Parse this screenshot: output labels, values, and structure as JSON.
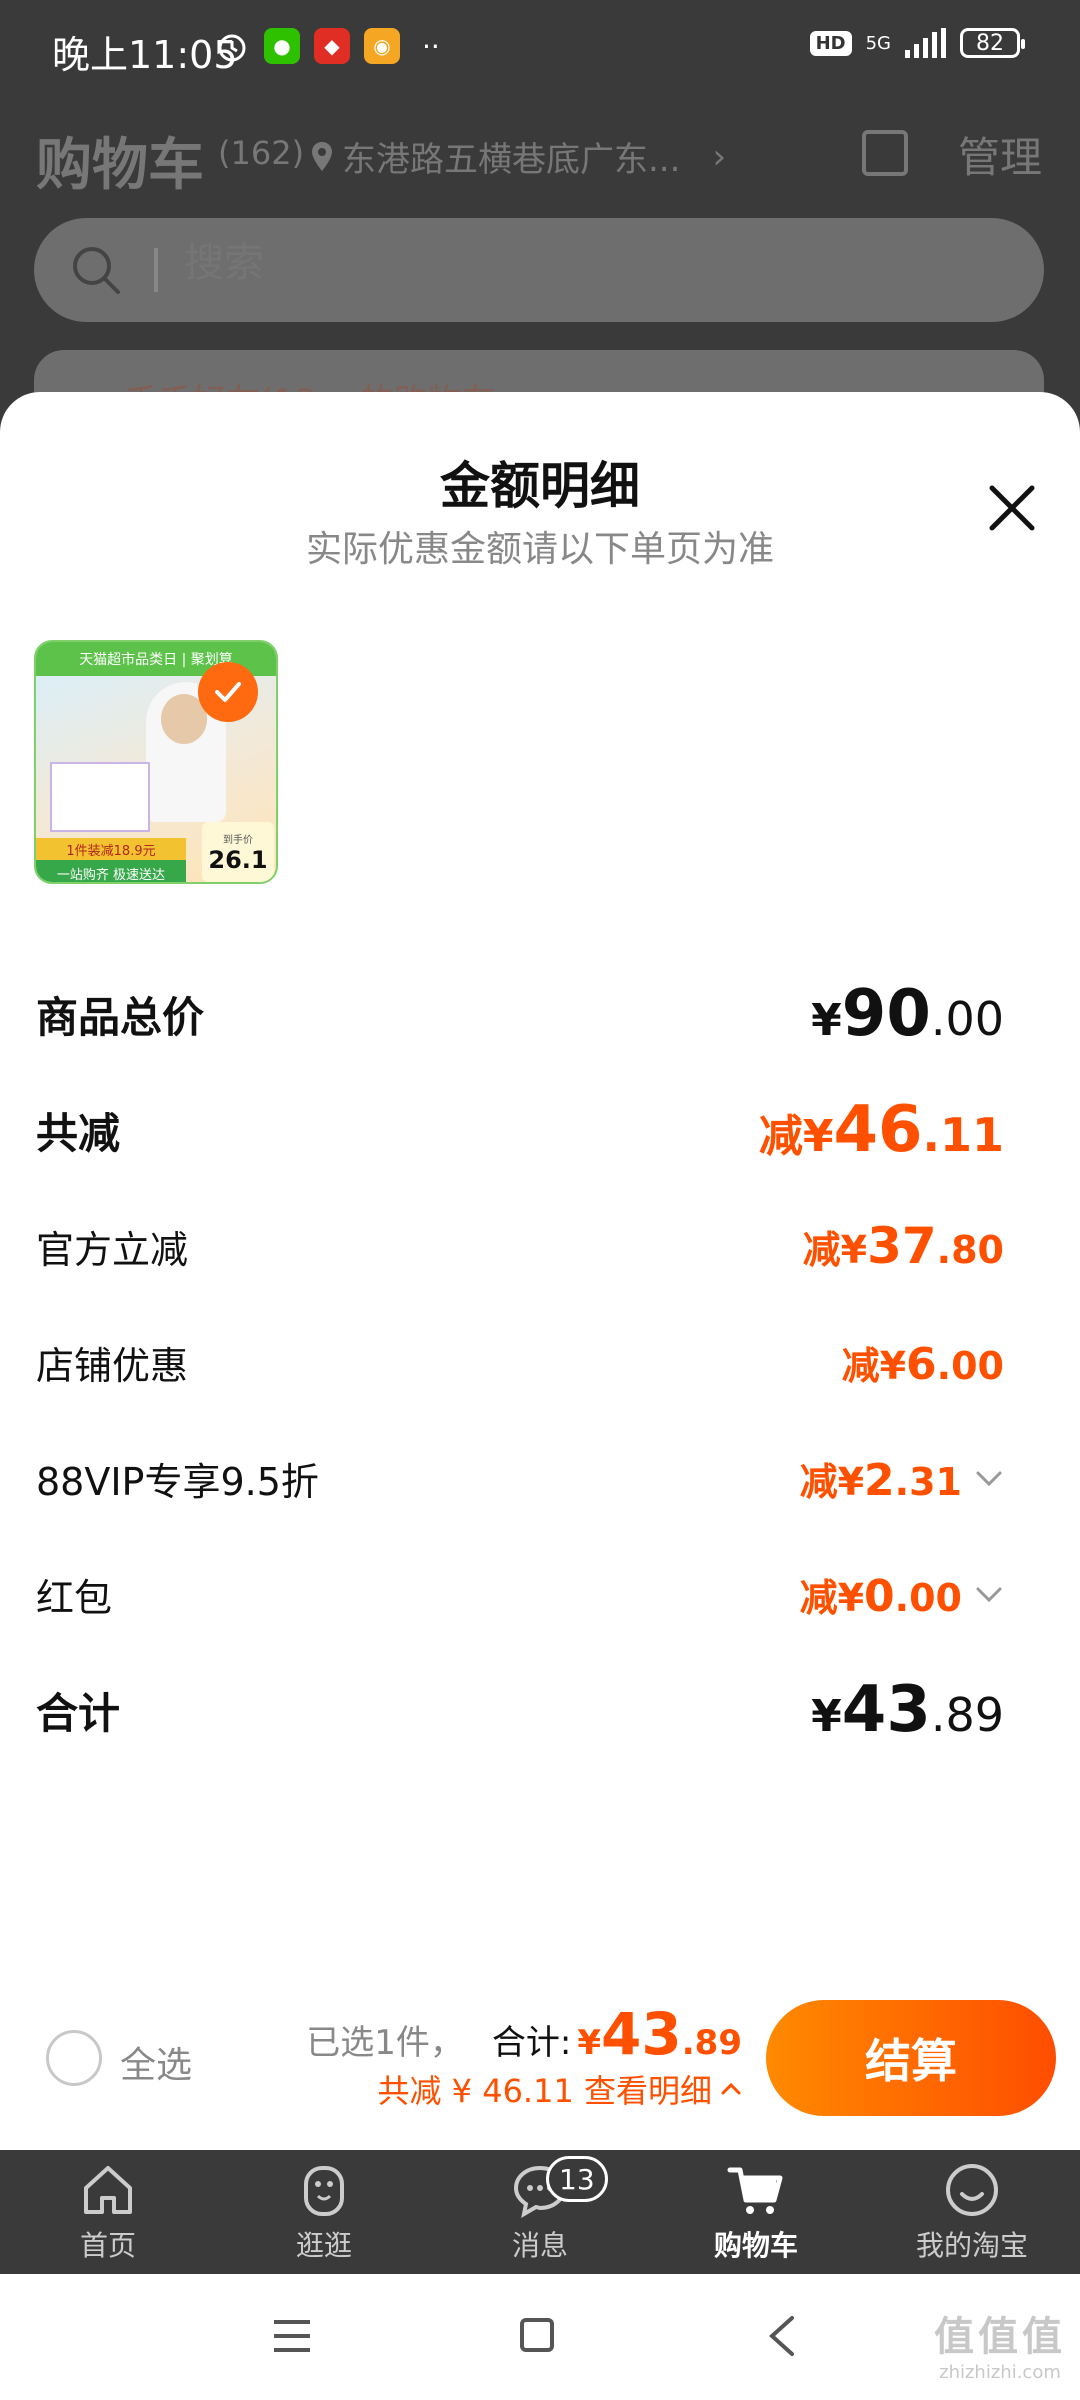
{
  "status_bar": {
    "time": "晚上11:05",
    "network": "5G",
    "hd": "HD",
    "battery": "82",
    "more": "··"
  },
  "cart": {
    "title": "购物车",
    "count": "(162)",
    "address": "东港路五横巷底广东...",
    "manage": "管理",
    "behind_text": "禾禾好友(13... 的购物车"
  },
  "search": {
    "placeholder": "搜索"
  },
  "modal": {
    "title": "金额明细",
    "subtitle": "实际优惠金额请以下单页为准",
    "product": {
      "banner": "天猫超市品类日 | 聚划算",
      "promo": "1件装减18.9元",
      "footer": "一站购齐 极速送达",
      "price_label": "到手价",
      "price": "26.1"
    },
    "rows": [
      {
        "label": "商品总价",
        "prefix": "",
        "sym": "¥",
        "int": "90",
        "dec": ".00"
      },
      {
        "label": "共减",
        "prefix": "减",
        "sym": "¥",
        "int": "46",
        "dec": ".11"
      },
      {
        "label": "官方立减",
        "prefix": "减",
        "sym": "¥",
        "int": "37",
        "dec": ".80"
      },
      {
        "label": "店铺优惠",
        "prefix": "减",
        "sym": "¥",
        "int": "6",
        "dec": ".00"
      },
      {
        "label": "88VIP专享9.5折",
        "prefix": "减",
        "sym": "¥",
        "int": "2",
        "dec": ".31"
      },
      {
        "label": "红包",
        "prefix": "减",
        "sym": "¥",
        "int": "0",
        "dec": ".00"
      },
      {
        "label": "合计",
        "prefix": "",
        "sym": "¥",
        "int": "43",
        "dec": ".89"
      }
    ]
  },
  "checkout": {
    "select_all": "全选",
    "selected": "已选1件，",
    "total_label": "合计:",
    "total_sym": "¥",
    "total_int": "43",
    "total_dec": ".89",
    "discount_text": "共减 ¥ 46.11  查看明细",
    "button": "结算"
  },
  "tabs": [
    {
      "label": "首页",
      "icon": "home-icon"
    },
    {
      "label": "逛逛",
      "icon": "browse-icon"
    },
    {
      "label": "消息",
      "icon": "message-icon",
      "badge": "13"
    },
    {
      "label": "购物车",
      "icon": "cart-icon",
      "active": true
    },
    {
      "label": "我的淘宝",
      "icon": "profile-icon"
    }
  ],
  "watermark": {
    "big": "值值值",
    "small": "zhizhizhi.com"
  },
  "colors": {
    "accent": "#ff5000",
    "dark": "#3a3a3a"
  }
}
